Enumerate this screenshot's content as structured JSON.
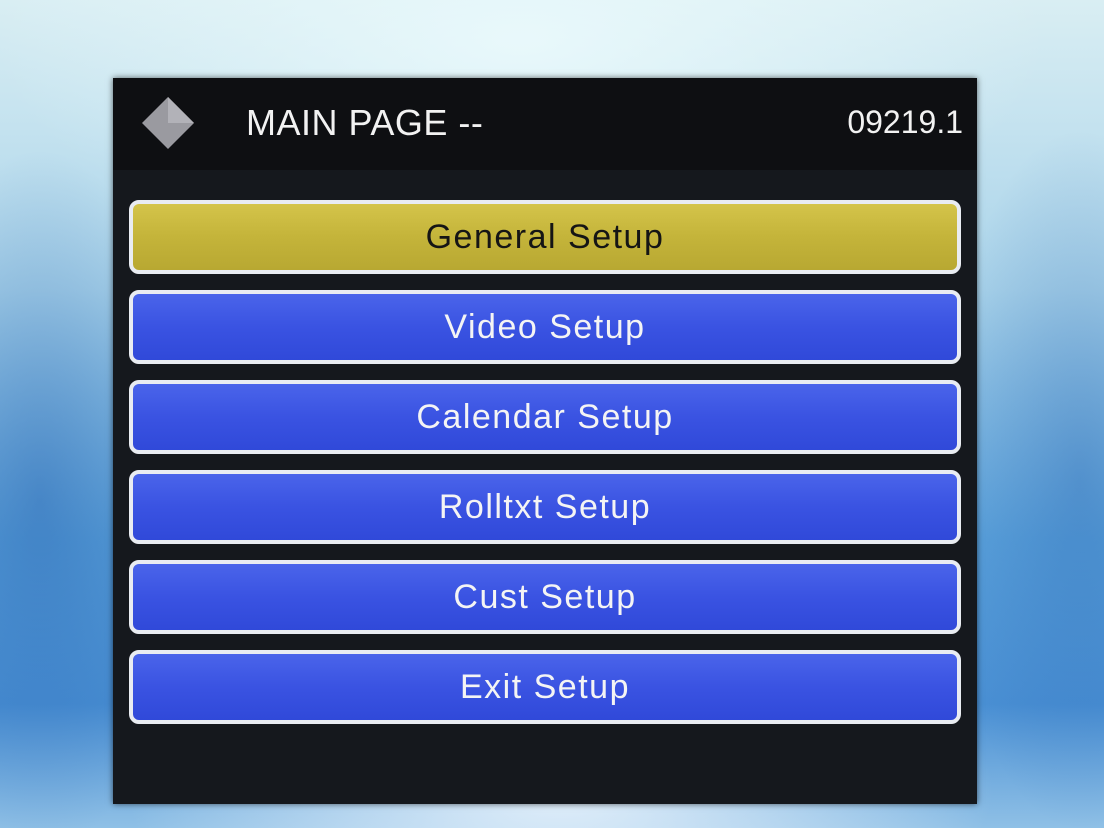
{
  "header": {
    "title": "MAIN PAGE --",
    "version": "09219.1",
    "logo_icon": "diamond-icon"
  },
  "menu": {
    "selected_index": 0,
    "items": [
      {
        "label": "General Setup"
      },
      {
        "label": "Video Setup"
      },
      {
        "label": "Calendar Setup"
      },
      {
        "label": "Rolltxt Setup"
      },
      {
        "label": "Cust Setup"
      },
      {
        "label": "Exit Setup"
      }
    ]
  },
  "colors": {
    "panel_bg": "#15181d",
    "item_bg": "#3a53e2",
    "selected_bg": "#c4b43a",
    "item_border": "#e9ecf2"
  }
}
